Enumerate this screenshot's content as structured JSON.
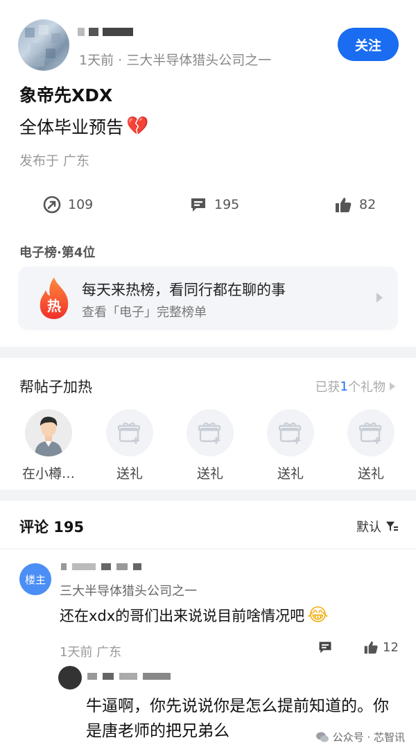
{
  "post": {
    "meta": "1天前 · 三大半导体猎头公司之一",
    "follow_label": "关注",
    "title": "象帝先XDX",
    "body": "全体毕业预告",
    "body_emoji": "💔",
    "location": "发布于 广东",
    "stats": {
      "share": "109",
      "comments": "195",
      "likes": "82"
    }
  },
  "rank": {
    "title": "电子榜·第4位",
    "main": "每天来热榜，看同行都在聊的事",
    "sub": "查看「电子」完整榜单",
    "fire_glyph": "热"
  },
  "heat": {
    "title": "帮帖子加热",
    "gift_prefix": "已获",
    "gift_num": "1",
    "gift_suffix": "个礼物",
    "slots": [
      {
        "label": "在小樽…",
        "type": "avatar"
      },
      {
        "label": "送礼",
        "type": "gift"
      },
      {
        "label": "送礼",
        "type": "gift"
      },
      {
        "label": "送礼",
        "type": "gift"
      },
      {
        "label": "送礼",
        "type": "gift"
      }
    ]
  },
  "comments": {
    "header": "评论 195",
    "sort_label": "默认",
    "first": {
      "badge": "楼主",
      "meta": "三大半导体猎头公司之一",
      "text": "还在xdx的哥们出来说说目前啥情况吧",
      "emoji": "😂",
      "foot": "1天前 广东",
      "likes": "12"
    },
    "reply": {
      "text": "牛逼啊，你先说说你是怎么提前知道的。你是唐老师的把兄弟么"
    }
  },
  "watermark": "公众号 · 芯智讯",
  "colors": {
    "accent": "#1a6cf0",
    "fire": "#f24b2a"
  }
}
